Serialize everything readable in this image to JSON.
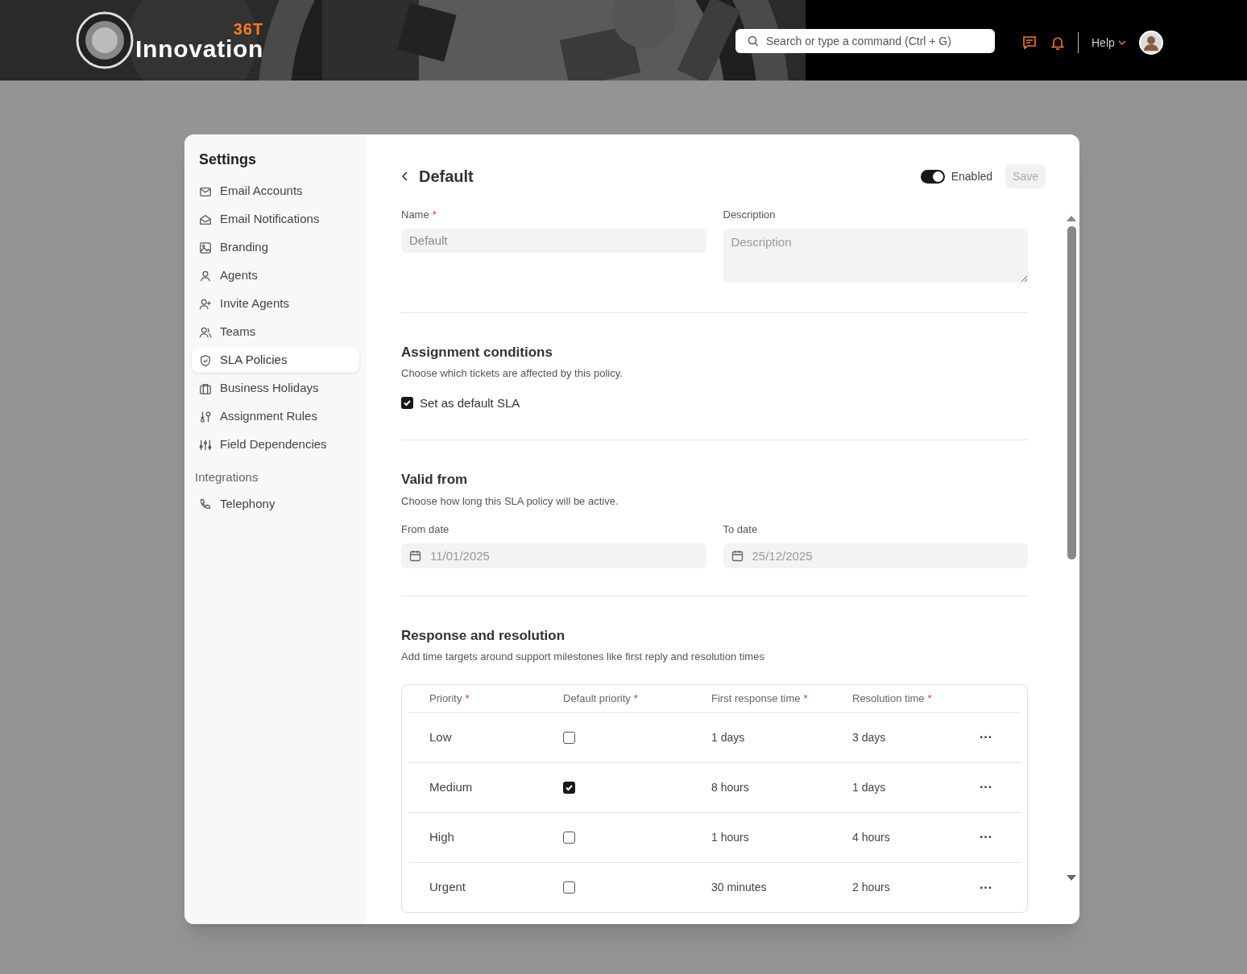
{
  "header": {
    "logo": {
      "name": "Innovation",
      "mark": "36T"
    },
    "search": {
      "placeholder": "Search or type a command (Ctrl + G)"
    },
    "help": "Help"
  },
  "sidebar": {
    "title": "Settings",
    "items": [
      {
        "label": "Email Accounts",
        "selected": false
      },
      {
        "label": "Email Notifications",
        "selected": false
      },
      {
        "label": "Branding",
        "selected": false
      },
      {
        "label": "Agents",
        "selected": false
      },
      {
        "label": "Invite Agents",
        "selected": false
      },
      {
        "label": "Teams",
        "selected": false
      },
      {
        "label": "SLA Policies",
        "selected": true
      },
      {
        "label": "Business Holidays",
        "selected": false
      },
      {
        "label": "Assignment Rules",
        "selected": false
      },
      {
        "label": "Field Dependencies",
        "selected": false
      }
    ],
    "section": "Integrations",
    "section_items": [
      {
        "label": "Telephony",
        "selected": false
      }
    ]
  },
  "policy": {
    "title": "Default",
    "enabled": true,
    "enabled_label": "Enabled",
    "save": "Save",
    "name": {
      "label": "Name",
      "required_mark": "*",
      "value": "Default"
    },
    "description": {
      "label": "Description",
      "placeholder": "Description"
    },
    "assignment": {
      "title": "Assignment conditions",
      "subtitle": "Choose which tickets are affected by this policy.",
      "default_sla": {
        "label": "Set as default SLA",
        "checked": true
      }
    },
    "valid_from": {
      "title": "Valid from",
      "subtitle": "Choose how long this SLA policy will be active.",
      "from": {
        "label": "From date",
        "value": "11/01/2025"
      },
      "to": {
        "label": "To date",
        "value": "25/12/2025"
      }
    },
    "response": {
      "title": "Response and resolution",
      "subtitle": "Add time targets around support milestones like first reply and resolution times",
      "columns": [
        {
          "label": "Priority",
          "required_mark": "*"
        },
        {
          "label": "Default priority",
          "required_mark": "*"
        },
        {
          "label": "First response time",
          "required_mark": "*"
        },
        {
          "label": "Resolution time",
          "required_mark": "*"
        }
      ],
      "rows": [
        {
          "priority": "Low",
          "default": false,
          "first_response": "1 days",
          "resolution": "3 days",
          "menu": "···"
        },
        {
          "priority": "Medium",
          "default": true,
          "first_response": "8 hours",
          "resolution": "1 days",
          "menu": "···"
        },
        {
          "priority": "High",
          "default": false,
          "first_response": "1 hours",
          "resolution": "4 hours",
          "menu": "···"
        },
        {
          "priority": "Urgent",
          "default": false,
          "first_response": "30 minutes",
          "resolution": "2 hours",
          "menu": "···"
        }
      ]
    }
  }
}
